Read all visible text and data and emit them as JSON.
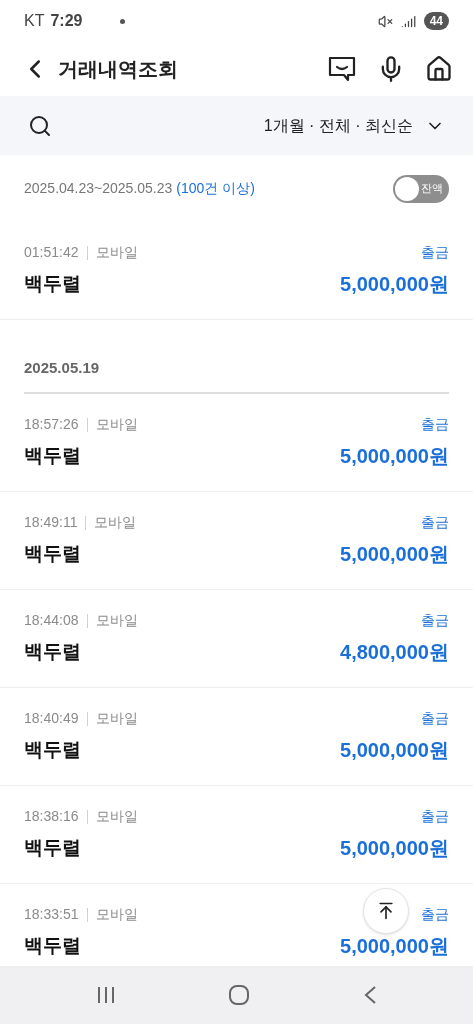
{
  "status_bar": {
    "carrier": "KT",
    "time": "7:29",
    "battery": "44"
  },
  "header": {
    "title": "거래내역조회"
  },
  "filter": {
    "label": "1개월 · 전체 · 최신순"
  },
  "period": {
    "range": "2025.04.23~2025.05.23",
    "count": "(100건 이상)",
    "balance_toggle": {
      "label": "잔액",
      "on": false
    }
  },
  "groups": [
    {
      "transactions": [
        {
          "time": "01:51:42",
          "channel": "모바일",
          "type": "출금",
          "name": "백두렬",
          "amount": "5,000,000원"
        }
      ]
    },
    {
      "date": "2025.05.19",
      "transactions": [
        {
          "time": "18:57:26",
          "channel": "모바일",
          "type": "출금",
          "name": "백두렬",
          "amount": "5,000,000원"
        },
        {
          "time": "18:49:11",
          "channel": "모바일",
          "type": "출금",
          "name": "백두렬",
          "amount": "5,000,000원"
        },
        {
          "time": "18:44:08",
          "channel": "모바일",
          "type": "출금",
          "name": "백두렬",
          "amount": "4,800,000원"
        },
        {
          "time": "18:40:49",
          "channel": "모바일",
          "type": "출금",
          "name": "백두렬",
          "amount": "5,000,000원"
        },
        {
          "time": "18:38:16",
          "channel": "모바일",
          "type": "출금",
          "name": "백두렬",
          "amount": "5,000,000원"
        },
        {
          "time": "18:33:51",
          "channel": "모바일",
          "type": "출금",
          "name": "백두렬",
          "amount": "5,000,000원"
        }
      ]
    }
  ]
}
